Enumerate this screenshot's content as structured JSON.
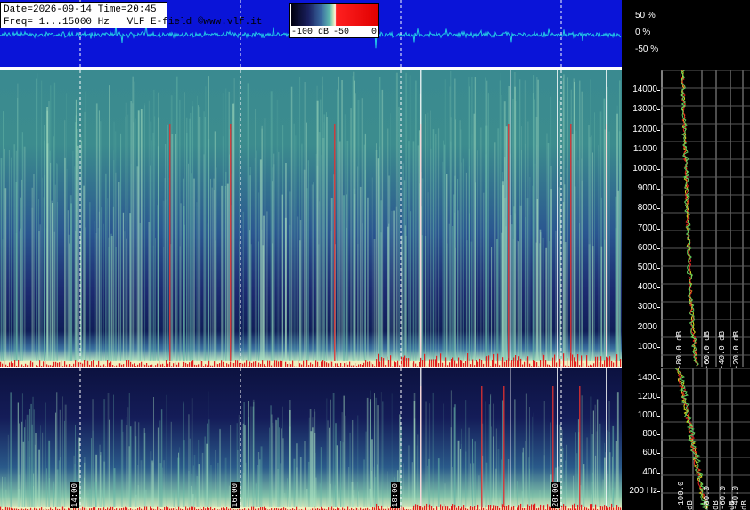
{
  "header": {
    "line1": "Date=2026-09-14 Time=20:45",
    "line2": "Freq= 1...15000 Hz   VLF E-field ©www.vlf.it"
  },
  "colorbar": {
    "labels": [
      "-100 dB",
      "-50",
      "0"
    ],
    "stops": [
      "#000010",
      "#1a2060",
      "#3a6aa0",
      "#60c0b0",
      "#f0f0c0",
      "#ffffff",
      "#ff2020",
      "#e00000"
    ]
  },
  "waveform_axis": {
    "labels": [
      "50 %",
      "0 %",
      "-50 %"
    ],
    "color": "#22c8e6",
    "background": "#0a14d8"
  },
  "chart_data": [
    {
      "type": "heatmap",
      "name_hint": "upper spectrogram",
      "ylim": [
        0,
        15000
      ],
      "y_ticks": [
        "1000",
        "2000",
        "3000",
        "4000",
        "5000",
        "6000",
        "7000",
        "8000",
        "9000",
        "10000",
        "11000",
        "12000",
        "13000",
        "14000"
      ],
      "y_tick_values": [
        1000,
        2000,
        3000,
        4000,
        5000,
        6000,
        7000,
        8000,
        9000,
        10000,
        11000,
        12000,
        13000,
        14000
      ],
      "x_time_labels": [
        "14:00",
        "16:00",
        "18:00",
        "20:00"
      ]
    },
    {
      "type": "heatmap",
      "name_hint": "lower spectrogram",
      "ylim": [
        0,
        1500
      ],
      "y_ticks": [
        "200 Hz",
        "400",
        "600",
        "800",
        "1000",
        "1200",
        "1400"
      ],
      "y_tick_values": [
        200,
        400,
        600,
        800,
        1000,
        1200,
        1400
      ],
      "x_time_labels": [
        "14:00",
        "16:00",
        "18:00",
        "20:00"
      ]
    },
    {
      "type": "line",
      "name_hint": "upper power profile",
      "x_ticks": [
        "-80.0 dB",
        "-60.0 dB",
        "-40.0 dB",
        "-20.0 dB"
      ]
    },
    {
      "type": "line",
      "name_hint": "lower power profile",
      "x_ticks": [
        "-100.0 dB",
        "-80.0 dB",
        "-60.0 dB",
        "-40.0 dB",
        "-20.0 dB"
      ]
    }
  ]
}
